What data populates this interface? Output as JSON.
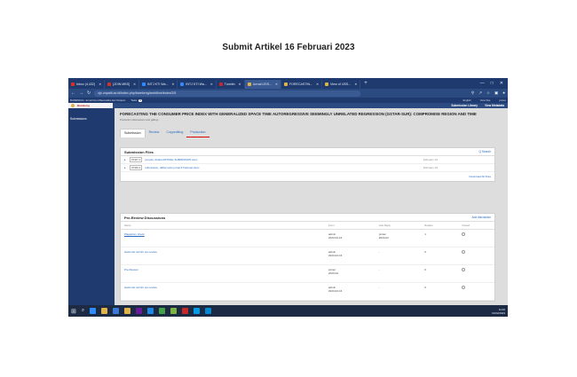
{
  "caption": "Submit Artikel 16 Februari 2023",
  "browser": {
    "tabs": [
      {
        "label": "Inbox (4,432)",
        "color": "#d93025"
      },
      {
        "label": "[JOIN MBS]",
        "color": "#d93025"
      },
      {
        "label": "INTJ KTI Wa...",
        "color": "#2d8cff"
      },
      {
        "label": "INTJ KTI Wa...",
        "color": "#2d8cff"
      },
      {
        "label": "Turnitin",
        "color": "#c62828"
      },
      {
        "label": "Jurnal IJSS...",
        "color": "#e0b24a"
      },
      {
        "label": "FORECASTIN...",
        "color": "#e0b24a"
      },
      {
        "label": "View of IJSS...",
        "color": "#e0b24a"
      }
    ],
    "new_tab": "+",
    "url": "ojs.unpatti.ac.id/index.php/barekeng/workflow/index/2/5",
    "window_controls": [
      "—",
      "□",
      "✕"
    ]
  },
  "app": {
    "context": "BAREKENG: Jurnal Ilmu Matematika dan Terapan",
    "tasks_label": "Tasks",
    "tasks_count": "0",
    "language": "English",
    "view_site": "View Site",
    "user": "pmtec",
    "logo_text": "Barekeng",
    "submission_library": "Submission Library",
    "view_metadata": "View Metadata"
  },
  "sidebar": {
    "items": [
      "Submissions"
    ]
  },
  "submission": {
    "title": "FORECASTING THE CONSUMER PRICE INDEX WITH GENERALIZED SPACE TIME AUTOREGRESSIVE SEEMINGLY UNRELATED REGRESSION (GSTAR-SUR): COMPROMISE REGION AND TIME",
    "meta": "Production discussions and galleys"
  },
  "stages": [
    "Submission",
    "Review",
    "Copyediting",
    "Production"
  ],
  "files_panel": {
    "title": "Submission Files",
    "action": "Q Search",
    "files": [
      {
        "id": "97427-1",
        "name": "penulis, Artikel ARTIKEL SUBMISSION.docx",
        "date": "February 16"
      },
      {
        "id": "97430-1",
        "name": "submission, daftar isian jurnal 9 Februari.docx",
        "date": "February 16"
      }
    ],
    "download_all": "Download All Files"
  },
  "discussions": {
    "title": "Pre-Review Discussions",
    "action": "Add discussion",
    "columns": [
      "Name",
      "From",
      "Last Reply",
      "Replies",
      "Closed"
    ],
    "rows": [
      {
        "name": "Plagiarism check",
        "from": "admin",
        "from2": "2023-02-16",
        "last": "pmtec",
        "last2": "2023-02",
        "replies": "1",
        "underline": true
      },
      {
        "name": "Hasil cek turnitin pre-review",
        "from": "admin",
        "from2": "2023-02-16",
        "last": "-",
        "last2": "",
        "replies": "0",
        "underline": false
      },
      {
        "name": "Pre-Review",
        "from": "pmtec",
        "from2": "2023-02",
        "last": "-",
        "last2": "",
        "replies": "0",
        "underline": false
      },
      {
        "name": "Hasil cek turnitin pre-review",
        "from": "admin",
        "from2": "2023-02-16",
        "last": "-",
        "last2": "",
        "replies": "0",
        "underline": false
      }
    ]
  },
  "taskbar": {
    "icons": [
      "#2d8cff",
      "#e0b24a",
      "#3b78d8",
      "#e0b24a",
      "#6a1b9a",
      "#1e88e5",
      "#43a047",
      "#7cb342",
      "#c62828",
      "#039be5",
      "#0288d1"
    ],
    "time": "11:00",
    "date": "16/02/2023"
  }
}
